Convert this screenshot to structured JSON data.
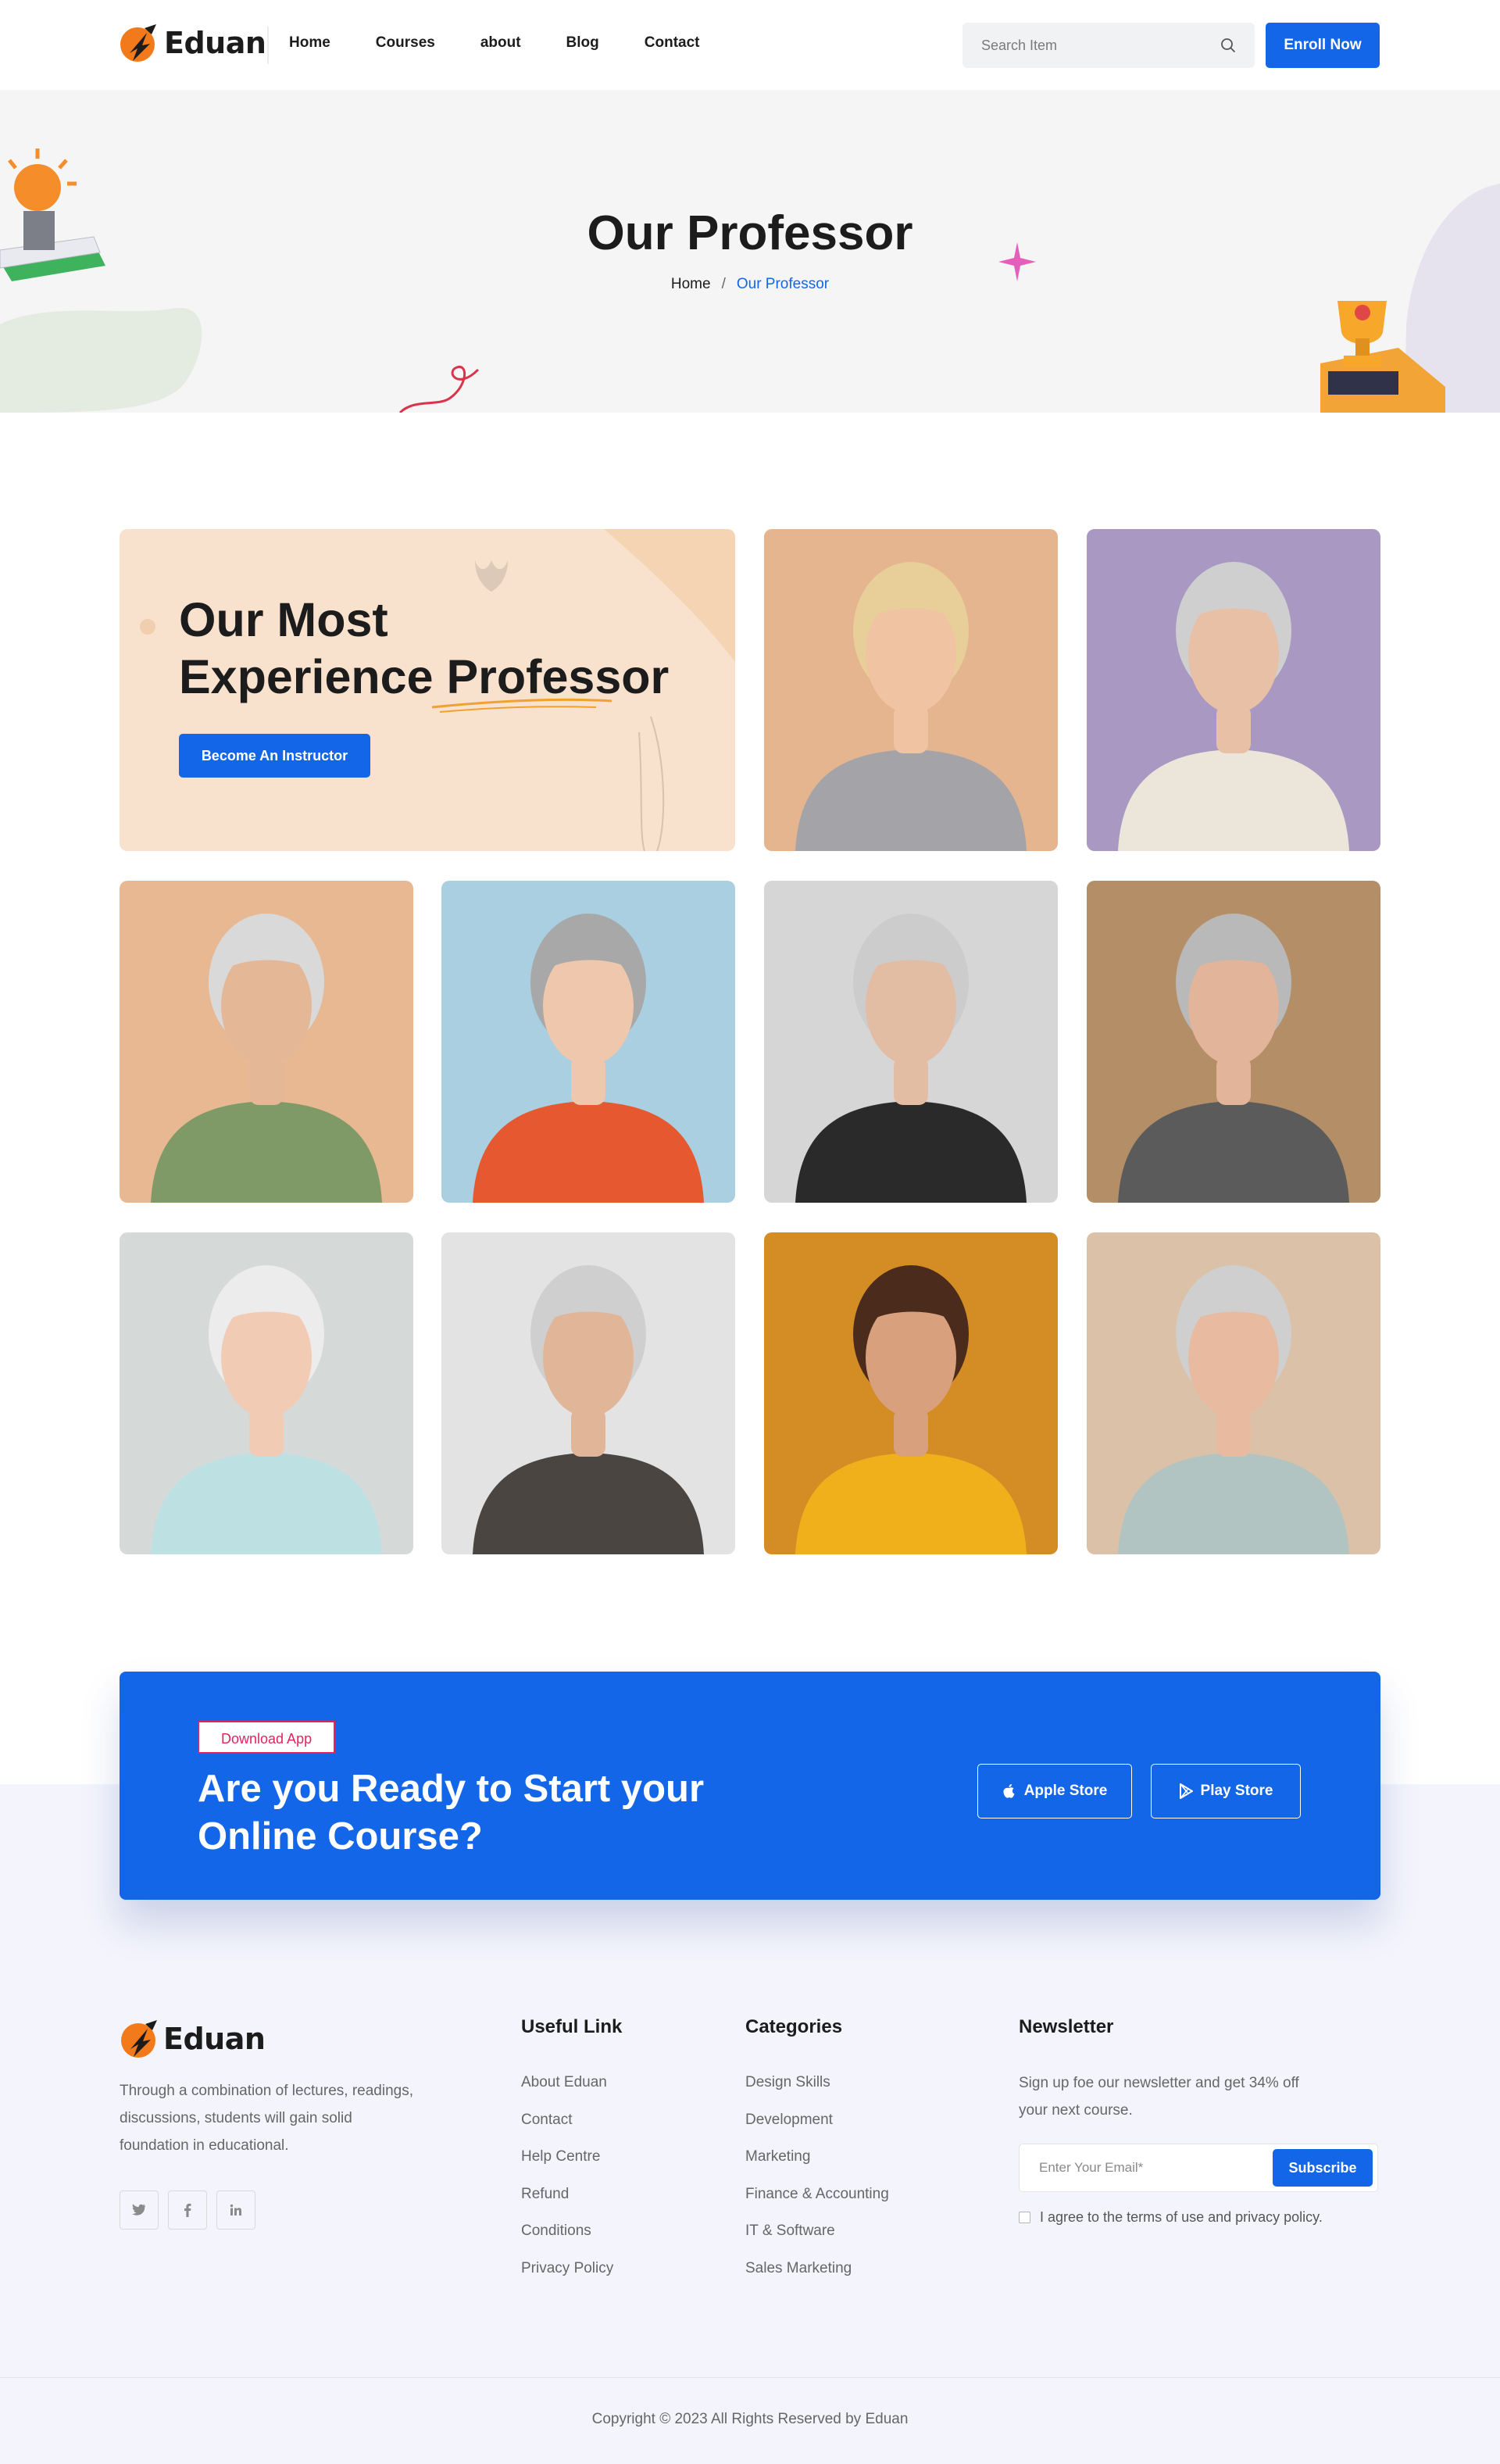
{
  "header": {
    "logo_text": "Eduan",
    "nav": [
      "Home",
      "Courses",
      "about",
      "Blog",
      "Contact"
    ],
    "search_placeholder": "Search Item",
    "enroll_label": "Enroll Now"
  },
  "hero": {
    "title": "Our Professor",
    "breadcrumb_home": "Home",
    "breadcrumb_sep": "/",
    "breadcrumb_current": "Our Professor"
  },
  "intro": {
    "title_line1": "Our Most",
    "title_line2": "Experience Professor",
    "button_label": "Become An Instructor"
  },
  "professors": [
    {
      "bg": "#e4b58f",
      "hair": "#e8cf99",
      "skin": "#f0c3a3",
      "shirt": "#a3a3a8"
    },
    {
      "bg": "#a898c2",
      "hair": "#cfcfcf",
      "skin": "#e8c0a6",
      "shirt": "#ece6da"
    },
    {
      "bg": "#e8b892",
      "hair": "#d9d9d9",
      "skin": "#e4b797",
      "shirt": "#7f9a66"
    },
    {
      "bg": "#a9cfe0",
      "hair": "#a8a8a8",
      "skin": "#eec7ad",
      "shirt": "#e6582f"
    },
    {
      "bg": "#d6d6d6",
      "hair": "#cccccc",
      "skin": "#e3bca4",
      "shirt": "#2a2a2a"
    },
    {
      "bg": "#b38e67",
      "hair": "#b9b9b9",
      "skin": "#e2b499",
      "shirt": "#5b5b5b"
    },
    {
      "bg": "#d5dad9",
      "hair": "#ececec",
      "skin": "#f1cbb4",
      "shirt": "#bde0e3"
    },
    {
      "bg": "#e3e3e3",
      "hair": "#cfcfcf",
      "skin": "#e1b598",
      "shirt": "#4a4541"
    },
    {
      "bg": "#d48c24",
      "hair": "#4a2b1c",
      "skin": "#d8a07c",
      "shirt": "#f0b01c"
    },
    {
      "bg": "#dbc1a8",
      "hair": "#cfcfcf",
      "skin": "#e8bba0",
      "shirt": "#b2c4c1"
    }
  ],
  "cta": {
    "badge": "Download App",
    "title": "Are you Ready to Start your Online Course?",
    "apple_label": "Apple Store",
    "play_label": "Play Store"
  },
  "footer": {
    "logo_text": "Eduan",
    "description": "Through a combination of lectures, readings, discussions, students will gain solid foundation in educational.",
    "social_icons": [
      "twitter-icon",
      "facebook-icon",
      "linkedin-icon"
    ],
    "useful_title": "Useful Link",
    "useful_links": [
      "About Eduan",
      "Contact",
      "Help Centre",
      "Refund",
      "Conditions",
      "Privacy Policy"
    ],
    "categories_title": "Categories",
    "categories": [
      "Design Skills",
      "Development",
      "Marketing",
      "Finance & Accounting",
      "IT & Software",
      "Sales Marketing"
    ],
    "newsletter_title": "Newsletter",
    "newsletter_text": "Sign up foe our newsletter and get 34% off your next course.",
    "email_placeholder": "Enter Your Email*",
    "subscribe_label": "Subscribe",
    "agree_text": "I agree to the terms of use and privacy policy.",
    "copyright": "Copyright © 2023 All Rights Reserved by Eduan"
  },
  "colors": {
    "primary": "#1466e8",
    "accent_pink": "#e0245e",
    "logo_orange": "#f27a1a",
    "intro_bg": "#f8e1cd",
    "cta_section_bg": "#f3f4fc"
  }
}
